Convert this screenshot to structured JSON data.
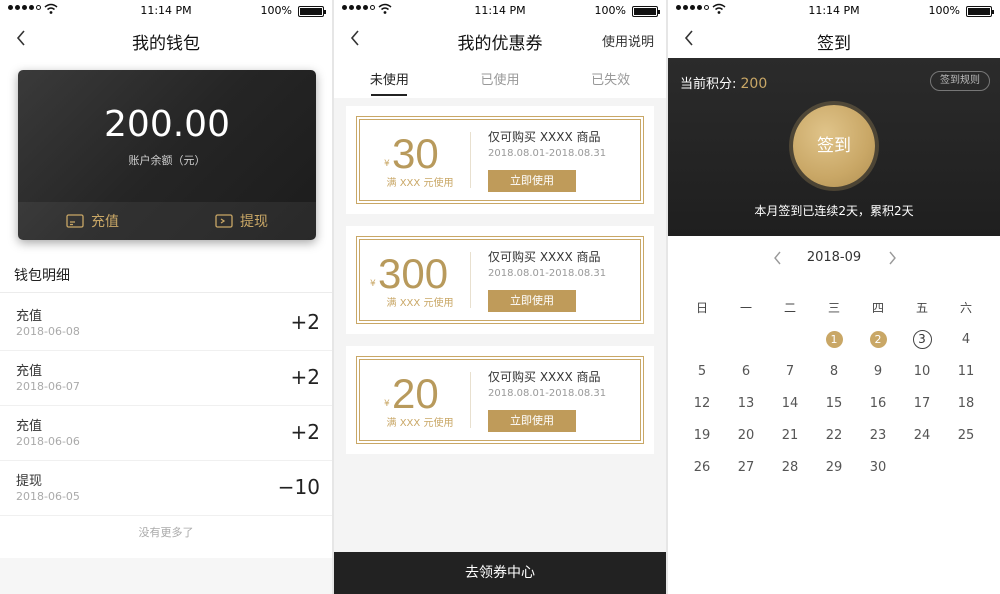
{
  "status": {
    "time": "11:14 PM",
    "battery": "100%"
  },
  "wallet": {
    "title": "我的钱包",
    "balance": "200.00",
    "balance_label": "账户余额（元）",
    "recharge": "充值",
    "withdraw": "提现",
    "details_title": "钱包明细",
    "transactions": [
      {
        "name": "充值",
        "date": "2018-06-08",
        "amount": "+2"
      },
      {
        "name": "充值",
        "date": "2018-06-07",
        "amount": "+2"
      },
      {
        "name": "充值",
        "date": "2018-06-06",
        "amount": "+2"
      },
      {
        "name": "提现",
        "date": "2018-06-05",
        "amount": "−10"
      }
    ],
    "no_more": "没有更多了"
  },
  "coupons": {
    "title": "我的优惠券",
    "help": "使用说明",
    "tabs": [
      "未使用",
      "已使用",
      "已失效"
    ],
    "currency": "¥",
    "items": [
      {
        "value": "30",
        "condition": "满 XXX 元使用",
        "desc": "仅可购买 XXXX 商品",
        "range": "2018.08.01-2018.08.31",
        "button": "立即使用"
      },
      {
        "value": "300",
        "condition": "满 XXX 元使用",
        "desc": "仅可购买 XXXX 商品",
        "range": "2018.08.01-2018.08.31",
        "button": "立即使用"
      },
      {
        "value": "20",
        "condition": "满 XXX 元使用",
        "desc": "仅可购买 XXXX 商品",
        "range": "2018.08.01-2018.08.31",
        "button": "立即使用"
      }
    ],
    "bottom_button": "去领券中心"
  },
  "signin": {
    "title": "签到",
    "points_label": "当前积分: ",
    "points": "200",
    "rules": "签到规则",
    "button": "签到",
    "summary": "本月签到已连续2天，累积2天",
    "month": "2018-09",
    "weekdays": [
      "日",
      "一",
      "二",
      "三",
      "四",
      "五",
      "六"
    ],
    "weeks": [
      [
        "",
        "",
        "",
        "1",
        "2",
        "3",
        "4"
      ],
      [
        "5",
        "6",
        "7",
        "8",
        "9",
        "10",
        "11"
      ],
      [
        "12",
        "13",
        "14",
        "15",
        "16",
        "17",
        "18"
      ],
      [
        "19",
        "20",
        "21",
        "22",
        "23",
        "24",
        "25"
      ],
      [
        "26",
        "27",
        "28",
        "29",
        "30",
        "",
        ""
      ]
    ],
    "signed_days": [
      "1",
      "2"
    ],
    "today": "3"
  },
  "colors": {
    "gold": "#c9a766",
    "dark": "#222222"
  }
}
